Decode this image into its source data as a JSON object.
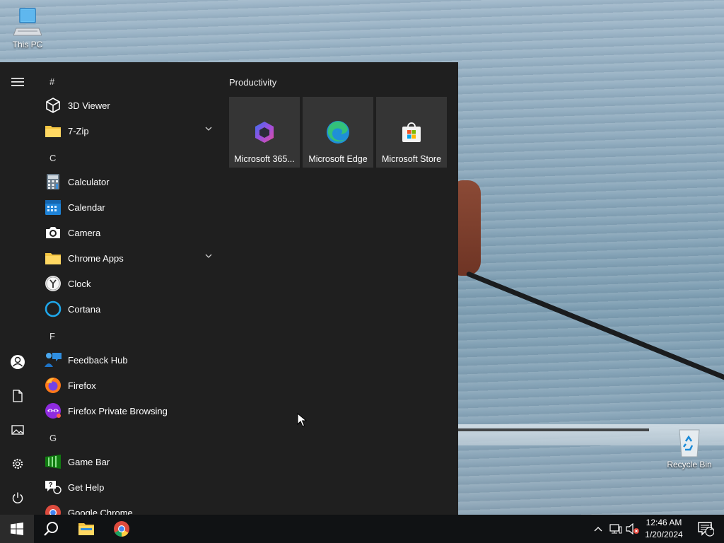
{
  "desktop": {
    "icons": [
      {
        "label": "This PC",
        "icon": "computer-icon"
      },
      {
        "label": "Recycle Bin",
        "icon": "recycle-bin-icon"
      }
    ]
  },
  "start_menu": {
    "rail": [
      "hamburger-menu-icon",
      "user-account-icon",
      "documents-icon",
      "pictures-icon",
      "settings-gear-icon",
      "power-icon"
    ],
    "letters": [
      "#",
      "C",
      "F",
      "G"
    ],
    "apps": [
      {
        "label": "3D Viewer",
        "icon": "3d-viewer-icon"
      },
      {
        "label": "7-Zip",
        "icon": "folder-icon",
        "expandable": true
      },
      {
        "label": "Calculator",
        "icon": "calculator-icon"
      },
      {
        "label": "Calendar",
        "icon": "calendar-icon"
      },
      {
        "label": "Camera",
        "icon": "camera-icon"
      },
      {
        "label": "Chrome Apps",
        "icon": "folder-icon",
        "expandable": true
      },
      {
        "label": "Clock",
        "icon": "clock-icon"
      },
      {
        "label": "Cortana",
        "icon": "cortana-icon"
      },
      {
        "label": "Feedback Hub",
        "icon": "feedback-hub-icon"
      },
      {
        "label": "Firefox",
        "icon": "firefox-icon"
      },
      {
        "label": "Firefox Private Browsing",
        "icon": "firefox-private-icon"
      },
      {
        "label": "Game Bar",
        "icon": "game-bar-icon"
      },
      {
        "label": "Get Help",
        "icon": "get-help-icon"
      },
      {
        "label": "Google Chrome",
        "icon": "chrome-icon"
      }
    ],
    "tile_group": "Productivity",
    "tiles": [
      {
        "label": "Microsoft 365...",
        "icon": "microsoft-365-icon"
      },
      {
        "label": "Microsoft Edge",
        "icon": "edge-icon"
      },
      {
        "label": "Microsoft Store",
        "icon": "store-icon"
      }
    ]
  },
  "taskbar": {
    "pinned": [
      "start-button-icon",
      "search-icon",
      "file-explorer-icon",
      "chrome-icon"
    ],
    "tray": [
      "show-hidden-icons-chevron",
      "network-icon",
      "volume-muted-icon"
    ],
    "time": "12:46 AM",
    "date": "1/20/2024",
    "notification_count": "1"
  },
  "colors": {
    "start_bg": "#1f1f1f",
    "tile_bg": "#353535",
    "taskbar_bg": "#101214"
  }
}
